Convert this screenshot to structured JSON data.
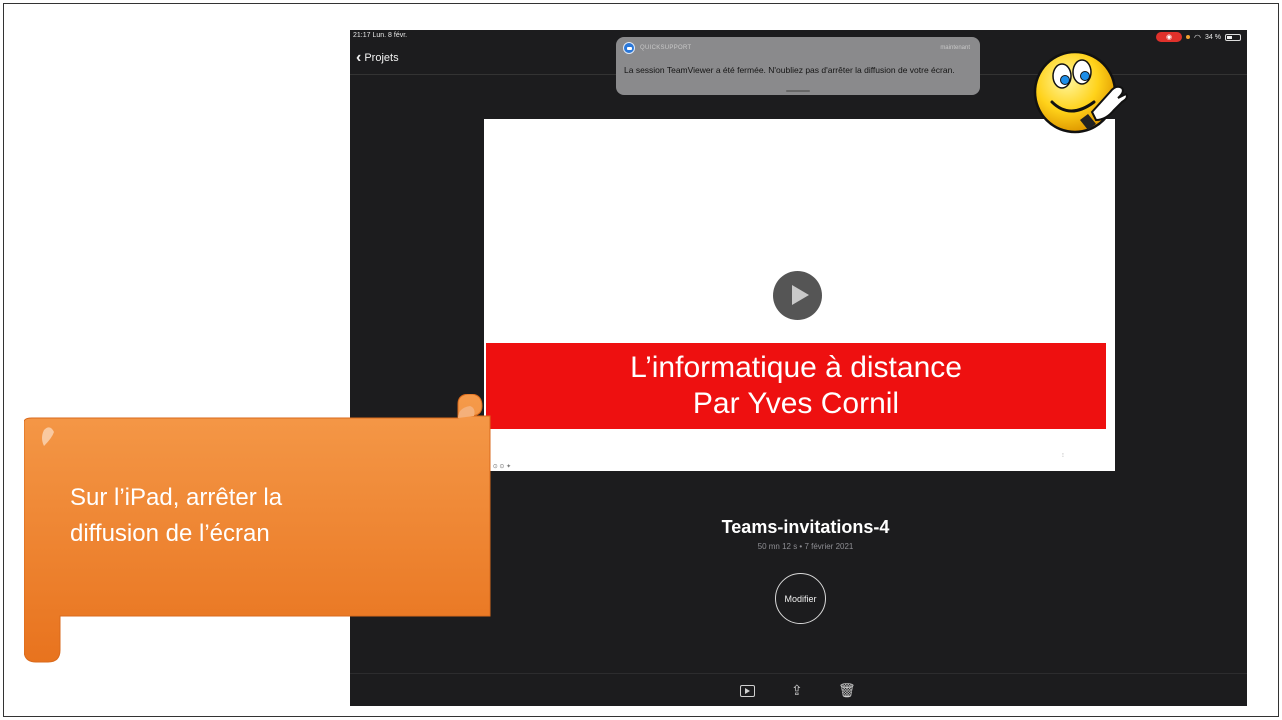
{
  "status_bar": {
    "time": "21:17  Lun. 8 févr.",
    "battery": "34 %"
  },
  "nav": {
    "back_label": "Projets"
  },
  "notification": {
    "app_name": "QUICKSUPPORT",
    "time": "maintenant",
    "message": "La session TeamViewer a été fermée. N'oubliez pas d'arrêter la diffusion de votre écran."
  },
  "preview": {
    "title_line1": "L’informatique à distance",
    "title_line2": "Par Yves Cornil"
  },
  "project": {
    "title": "Teams-invitations-4",
    "meta": "50 mn 12 s • 7 février 2021",
    "edit_label": "Modifier"
  },
  "callout": {
    "text_line1": "Sur l’iPad, arrêter la",
    "text_line2": "diffusion de l’écran"
  },
  "colors": {
    "ipad_background": "#1c1c1e",
    "banner_red": "#ee1010",
    "callout_orange": "#f08030",
    "record_indicator": "#e0312b"
  },
  "icons": {
    "back": "chevron-left-icon",
    "play_preview": "play-circle-icon",
    "bottom_play": "play-square-icon",
    "share": "share-icon",
    "trash": "trash-icon",
    "pointer_emoji": "pointing-smiley-icon"
  }
}
